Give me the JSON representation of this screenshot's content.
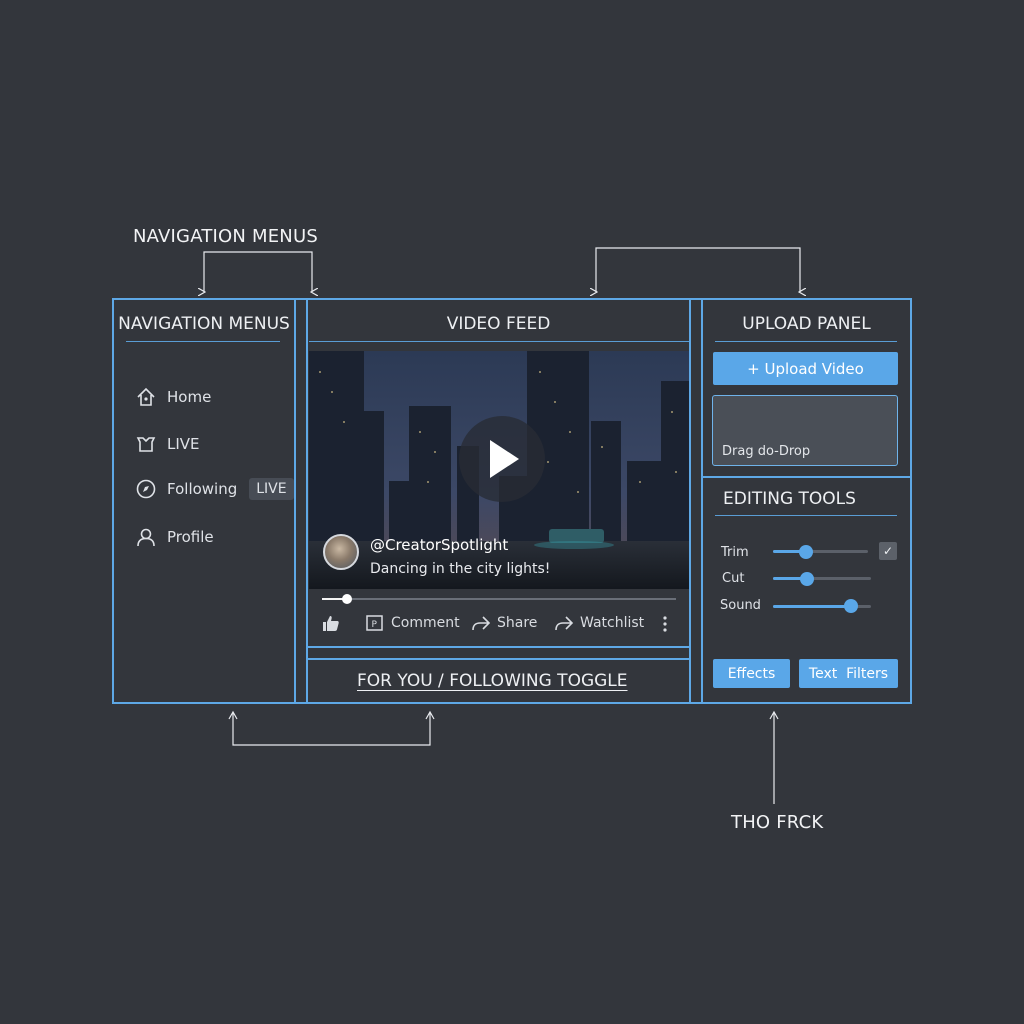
{
  "annotations": {
    "top_left": "NAVIGATION MENUS",
    "bottom_right": "THO FRCK"
  },
  "nav_panel": {
    "title": "NAVIGATION MENUS",
    "items": [
      {
        "label": "Home",
        "icon": "home-icon"
      },
      {
        "label": "LIVE",
        "icon": "live-icon"
      },
      {
        "label": "Following",
        "icon": "compass-icon",
        "badge": "LIVE"
      },
      {
        "label": "Profile",
        "icon": "profile-icon"
      }
    ]
  },
  "video_feed": {
    "title": "VIDEO FEED",
    "creator_handle": "@CreatorSpotlight",
    "caption": "Dancing in the city lights!",
    "progress": 0.07,
    "actions": {
      "comment": "Comment",
      "share": "Share",
      "watchlist": "Watchlist"
    },
    "toggle_label": "FOR YOU / FOLLOWING TOGGLE"
  },
  "upload_panel": {
    "title": "UPLOAD PANEL",
    "upload_button": "+ Upload Video",
    "drop_zone_text": "Drag do-Drop"
  },
  "editing_tools": {
    "title": "EDITING TOOLS",
    "sliders": [
      {
        "label": "Trim",
        "value": 0.35
      },
      {
        "label": "Cut",
        "value": 0.35
      },
      {
        "label": "Sound",
        "value": 0.8
      }
    ],
    "trim_checked": true,
    "buttons": {
      "effects": "Effects",
      "text_filters": "Text  Filters"
    }
  },
  "colors": {
    "background": "#33363c",
    "accent": "#5ea8e6",
    "button": "#5aa7e8"
  }
}
